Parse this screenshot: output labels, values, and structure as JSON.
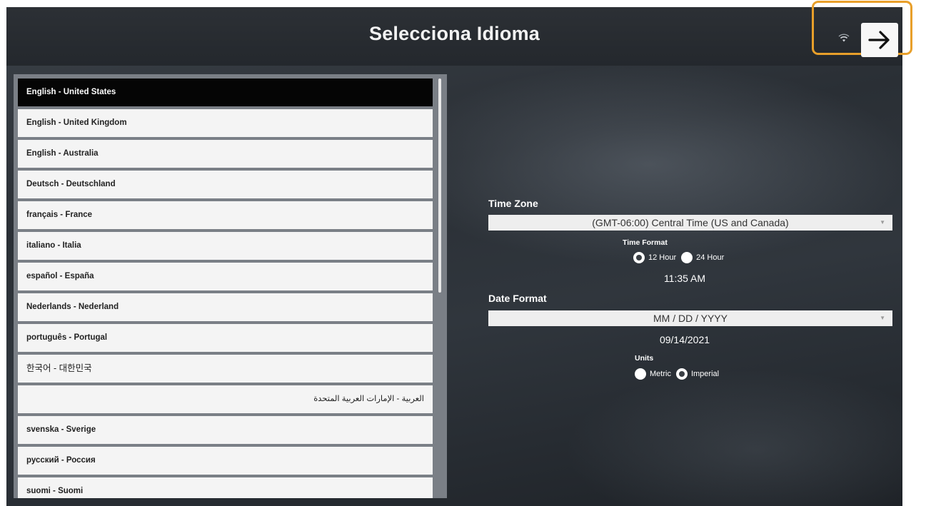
{
  "header": {
    "title": "Selecciona Idioma",
    "next_icon": "arrow-right-icon",
    "wifi_icon": "wifi-icon",
    "focus_color": "#e89f2a"
  },
  "languages": [
    {
      "label": "English - United States",
      "selected": true
    },
    {
      "label": "English - United Kingdom",
      "selected": false
    },
    {
      "label": "English - Australia",
      "selected": false
    },
    {
      "label": "Deutsch - Deutschland",
      "selected": false
    },
    {
      "label": "français - France",
      "selected": false
    },
    {
      "label": "italiano - Italia",
      "selected": false
    },
    {
      "label": "español - España",
      "selected": false
    },
    {
      "label": "Nederlands - Nederland",
      "selected": false
    },
    {
      "label": "português - Portugal",
      "selected": false
    },
    {
      "label": "한국어 - 대한민국",
      "selected": false
    },
    {
      "label": "العربية - الإمارات العربية المتحدة",
      "selected": false
    },
    {
      "label": "svenska - Sverige",
      "selected": false
    },
    {
      "label": "русский - Россия",
      "selected": false
    },
    {
      "label": "suomi - Suomi",
      "selected": false
    }
  ],
  "settings": {
    "time_zone_label": "Time Zone",
    "time_zone_value": "(GMT-06:00) Central Time (US and Canada)",
    "time_format_label": "Time Format",
    "time_format_options": [
      "12 Hour",
      "24 Hour"
    ],
    "time_format_selected": "12 Hour",
    "current_time": "11:35 AM",
    "date_format_label": "Date Format",
    "date_format_value": "MM / DD / YYYY",
    "current_date": "09/14/2021",
    "units_label": "Units",
    "units_options": [
      "Metric",
      "Imperial"
    ],
    "units_selected": "Imperial"
  }
}
